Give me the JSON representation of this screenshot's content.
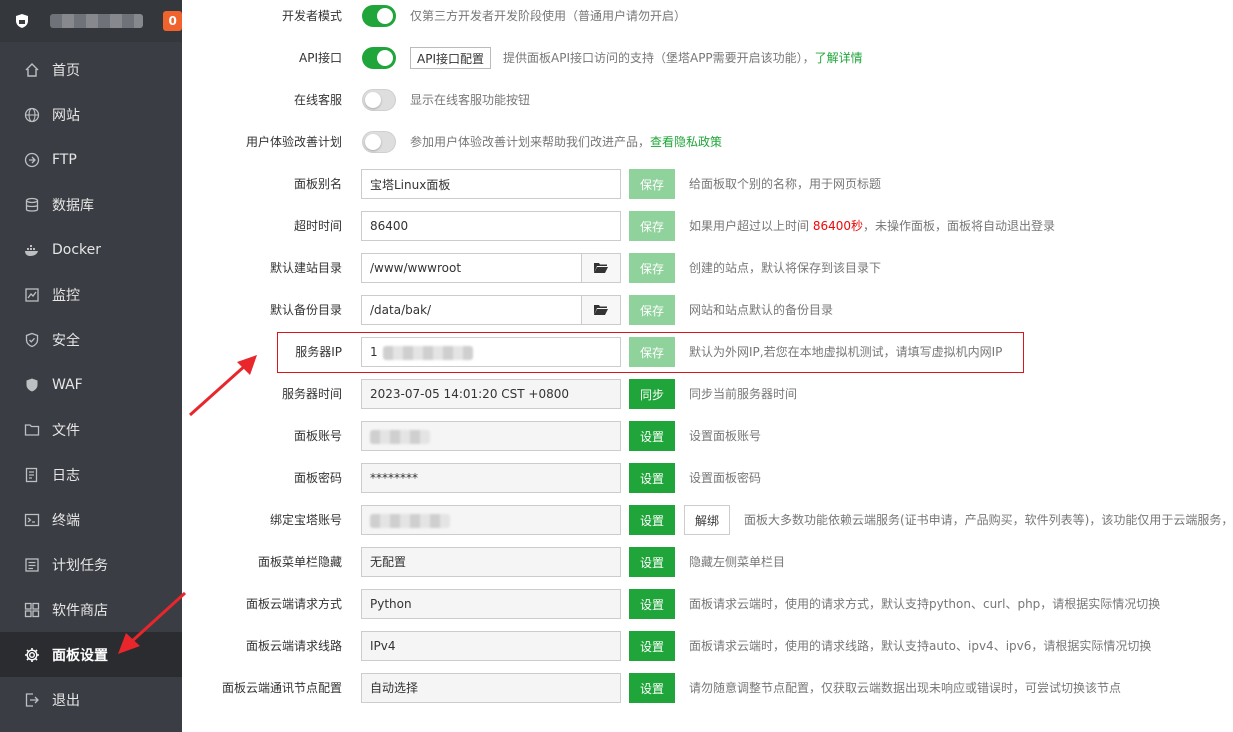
{
  "sidebar": {
    "badge": "0",
    "items": [
      {
        "label": "首页",
        "icon": "home-icon"
      },
      {
        "label": "网站",
        "icon": "globe-icon"
      },
      {
        "label": "FTP",
        "icon": "ftp-icon"
      },
      {
        "label": "数据库",
        "icon": "database-icon"
      },
      {
        "label": "Docker",
        "icon": "docker-icon"
      },
      {
        "label": "监控",
        "icon": "monitor-icon"
      },
      {
        "label": "安全",
        "icon": "shield-check-icon"
      },
      {
        "label": "WAF",
        "icon": "waf-shield-icon"
      },
      {
        "label": "文件",
        "icon": "folder-icon"
      },
      {
        "label": "日志",
        "icon": "log-icon"
      },
      {
        "label": "终端",
        "icon": "terminal-icon"
      },
      {
        "label": "计划任务",
        "icon": "schedule-icon"
      },
      {
        "label": "软件商店",
        "icon": "store-icon"
      },
      {
        "label": "面板设置",
        "icon": "gear-icon",
        "active": true
      },
      {
        "label": "退出",
        "icon": "logout-icon"
      }
    ]
  },
  "settings": {
    "dev_mode": {
      "label": "开发者模式",
      "on": true,
      "desc": "仅第三方开发者开发阶段使用（普通用户请勿开启）"
    },
    "api": {
      "label": "API接口",
      "on": true,
      "btn": "API接口配置",
      "desc": "提供面板API接口访问的支持（堡塔APP需要开启该功能），",
      "link": "了解详情"
    },
    "online_service": {
      "label": "在线客服",
      "on": false,
      "desc": "显示在线客服功能按钮"
    },
    "ux_plan": {
      "label": "用户体验改善计划",
      "on": false,
      "desc": "参加用户体验改善计划来帮助我们改进产品，",
      "link": "查看隐私政策"
    },
    "panel_alias": {
      "label": "面板别名",
      "value": "宝塔Linux面板",
      "btn": "保存",
      "desc": "给面板取个别的名称，用于网页标题"
    },
    "timeout": {
      "label": "超时时间",
      "value": "86400",
      "btn": "保存",
      "desc_pre": "如果用户超过以上时间 ",
      "desc_red": "86400秒",
      "desc_post": "，未操作面板，面板将自动退出登录"
    },
    "site_dir": {
      "label": "默认建站目录",
      "value": "/www/wwwroot",
      "btn": "保存",
      "desc": "创建的站点，默认将保存到该目录下"
    },
    "backup_dir": {
      "label": "默认备份目录",
      "value": "/data/bak/",
      "btn": "保存",
      "desc": "网站和站点默认的备份目录"
    },
    "server_ip": {
      "label": "服务器IP",
      "value_prefix": "1",
      "btn": "保存",
      "desc": "默认为外网IP,若您在本地虚拟机测试，请填写虚拟机内网IP"
    },
    "server_time": {
      "label": "服务器时间",
      "value": "2023-07-05 14:01:20 CST +0800",
      "btn": "同步",
      "desc": "同步当前服务器时间"
    },
    "panel_account": {
      "label": "面板账号",
      "btn": "设置",
      "desc": "设置面板账号"
    },
    "panel_password": {
      "label": "面板密码",
      "value": "********",
      "btn": "设置",
      "desc": "设置面板密码"
    },
    "bind_account": {
      "label": "绑定宝塔账号",
      "btn": "设置",
      "btn2": "解绑",
      "desc": "面板大多数功能依赖云端服务(证书申请，产品购买，软件列表等)，该功能仅用于云端服务，无"
    },
    "menu_hide": {
      "label": "面板菜单栏隐藏",
      "value": "无配置",
      "btn": "设置",
      "desc": "隐藏左侧菜单栏目"
    },
    "cloud_method": {
      "label": "面板云端请求方式",
      "value": "Python",
      "btn": "设置",
      "desc": "面板请求云端时，使用的请求方式，默认支持python、curl、php，请根据实际情况切换"
    },
    "cloud_route": {
      "label": "面板云端请求线路",
      "value": "IPv4",
      "btn": "设置",
      "desc": "面板请求云端时，使用的请求线路，默认支持auto、ipv4、ipv6，请根据实际情况切换"
    },
    "cloud_node": {
      "label": "面板云端通讯节点配置",
      "value": "自动选择",
      "btn": "设置",
      "desc": "请勿随意调整节点配置，仅获取云端数据出现未响应或错误时，可尝试切换该节点"
    }
  },
  "colors": {
    "accent": "#20a53a",
    "sidebar": "#3a3d43",
    "highlight": "#d9161c"
  }
}
